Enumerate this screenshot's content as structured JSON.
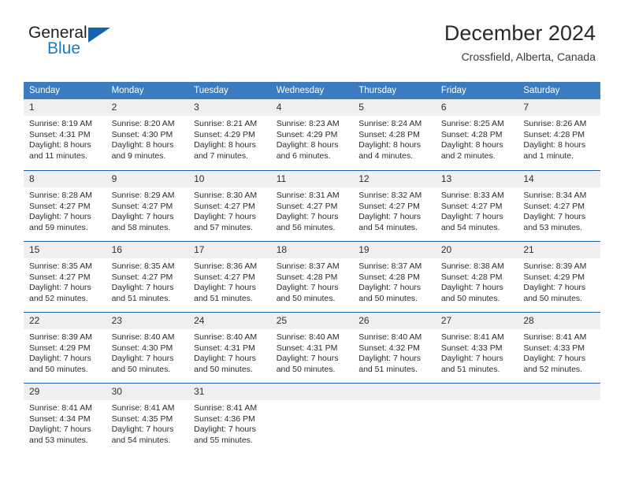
{
  "brand": {
    "name_primary": "General",
    "name_secondary": "Blue",
    "triangle_color": "#1665ab"
  },
  "header": {
    "title": "December 2024",
    "location": "Crossfield, Alberta, Canada"
  },
  "calendar": {
    "weekday_headers": [
      "Sunday",
      "Monday",
      "Tuesday",
      "Wednesday",
      "Thursday",
      "Friday",
      "Saturday"
    ],
    "header_bg": "#3b7cc0",
    "row_divider_color": "#1f61a8",
    "daynum_bg": "#efefef",
    "weeks": [
      [
        {
          "day": "1",
          "sunrise": "Sunrise: 8:19 AM",
          "sunset": "Sunset: 4:31 PM",
          "daylight_1": "Daylight: 8 hours",
          "daylight_2": "and 11 minutes."
        },
        {
          "day": "2",
          "sunrise": "Sunrise: 8:20 AM",
          "sunset": "Sunset: 4:30 PM",
          "daylight_1": "Daylight: 8 hours",
          "daylight_2": "and 9 minutes."
        },
        {
          "day": "3",
          "sunrise": "Sunrise: 8:21 AM",
          "sunset": "Sunset: 4:29 PM",
          "daylight_1": "Daylight: 8 hours",
          "daylight_2": "and 7 minutes."
        },
        {
          "day": "4",
          "sunrise": "Sunrise: 8:23 AM",
          "sunset": "Sunset: 4:29 PM",
          "daylight_1": "Daylight: 8 hours",
          "daylight_2": "and 6 minutes."
        },
        {
          "day": "5",
          "sunrise": "Sunrise: 8:24 AM",
          "sunset": "Sunset: 4:28 PM",
          "daylight_1": "Daylight: 8 hours",
          "daylight_2": "and 4 minutes."
        },
        {
          "day": "6",
          "sunrise": "Sunrise: 8:25 AM",
          "sunset": "Sunset: 4:28 PM",
          "daylight_1": "Daylight: 8 hours",
          "daylight_2": "and 2 minutes."
        },
        {
          "day": "7",
          "sunrise": "Sunrise: 8:26 AM",
          "sunset": "Sunset: 4:28 PM",
          "daylight_1": "Daylight: 8 hours",
          "daylight_2": "and 1 minute."
        }
      ],
      [
        {
          "day": "8",
          "sunrise": "Sunrise: 8:28 AM",
          "sunset": "Sunset: 4:27 PM",
          "daylight_1": "Daylight: 7 hours",
          "daylight_2": "and 59 minutes."
        },
        {
          "day": "9",
          "sunrise": "Sunrise: 8:29 AM",
          "sunset": "Sunset: 4:27 PM",
          "daylight_1": "Daylight: 7 hours",
          "daylight_2": "and 58 minutes."
        },
        {
          "day": "10",
          "sunrise": "Sunrise: 8:30 AM",
          "sunset": "Sunset: 4:27 PM",
          "daylight_1": "Daylight: 7 hours",
          "daylight_2": "and 57 minutes."
        },
        {
          "day": "11",
          "sunrise": "Sunrise: 8:31 AM",
          "sunset": "Sunset: 4:27 PM",
          "daylight_1": "Daylight: 7 hours",
          "daylight_2": "and 56 minutes."
        },
        {
          "day": "12",
          "sunrise": "Sunrise: 8:32 AM",
          "sunset": "Sunset: 4:27 PM",
          "daylight_1": "Daylight: 7 hours",
          "daylight_2": "and 54 minutes."
        },
        {
          "day": "13",
          "sunrise": "Sunrise: 8:33 AM",
          "sunset": "Sunset: 4:27 PM",
          "daylight_1": "Daylight: 7 hours",
          "daylight_2": "and 54 minutes."
        },
        {
          "day": "14",
          "sunrise": "Sunrise: 8:34 AM",
          "sunset": "Sunset: 4:27 PM",
          "daylight_1": "Daylight: 7 hours",
          "daylight_2": "and 53 minutes."
        }
      ],
      [
        {
          "day": "15",
          "sunrise": "Sunrise: 8:35 AM",
          "sunset": "Sunset: 4:27 PM",
          "daylight_1": "Daylight: 7 hours",
          "daylight_2": "and 52 minutes."
        },
        {
          "day": "16",
          "sunrise": "Sunrise: 8:35 AM",
          "sunset": "Sunset: 4:27 PM",
          "daylight_1": "Daylight: 7 hours",
          "daylight_2": "and 51 minutes."
        },
        {
          "day": "17",
          "sunrise": "Sunrise: 8:36 AM",
          "sunset": "Sunset: 4:27 PM",
          "daylight_1": "Daylight: 7 hours",
          "daylight_2": "and 51 minutes."
        },
        {
          "day": "18",
          "sunrise": "Sunrise: 8:37 AM",
          "sunset": "Sunset: 4:28 PM",
          "daylight_1": "Daylight: 7 hours",
          "daylight_2": "and 50 minutes."
        },
        {
          "day": "19",
          "sunrise": "Sunrise: 8:37 AM",
          "sunset": "Sunset: 4:28 PM",
          "daylight_1": "Daylight: 7 hours",
          "daylight_2": "and 50 minutes."
        },
        {
          "day": "20",
          "sunrise": "Sunrise: 8:38 AM",
          "sunset": "Sunset: 4:28 PM",
          "daylight_1": "Daylight: 7 hours",
          "daylight_2": "and 50 minutes."
        },
        {
          "day": "21",
          "sunrise": "Sunrise: 8:39 AM",
          "sunset": "Sunset: 4:29 PM",
          "daylight_1": "Daylight: 7 hours",
          "daylight_2": "and 50 minutes."
        }
      ],
      [
        {
          "day": "22",
          "sunrise": "Sunrise: 8:39 AM",
          "sunset": "Sunset: 4:29 PM",
          "daylight_1": "Daylight: 7 hours",
          "daylight_2": "and 50 minutes."
        },
        {
          "day": "23",
          "sunrise": "Sunrise: 8:40 AM",
          "sunset": "Sunset: 4:30 PM",
          "daylight_1": "Daylight: 7 hours",
          "daylight_2": "and 50 minutes."
        },
        {
          "day": "24",
          "sunrise": "Sunrise: 8:40 AM",
          "sunset": "Sunset: 4:31 PM",
          "daylight_1": "Daylight: 7 hours",
          "daylight_2": "and 50 minutes."
        },
        {
          "day": "25",
          "sunrise": "Sunrise: 8:40 AM",
          "sunset": "Sunset: 4:31 PM",
          "daylight_1": "Daylight: 7 hours",
          "daylight_2": "and 50 minutes."
        },
        {
          "day": "26",
          "sunrise": "Sunrise: 8:40 AM",
          "sunset": "Sunset: 4:32 PM",
          "daylight_1": "Daylight: 7 hours",
          "daylight_2": "and 51 minutes."
        },
        {
          "day": "27",
          "sunrise": "Sunrise: 8:41 AM",
          "sunset": "Sunset: 4:33 PM",
          "daylight_1": "Daylight: 7 hours",
          "daylight_2": "and 51 minutes."
        },
        {
          "day": "28",
          "sunrise": "Sunrise: 8:41 AM",
          "sunset": "Sunset: 4:33 PM",
          "daylight_1": "Daylight: 7 hours",
          "daylight_2": "and 52 minutes."
        }
      ],
      [
        {
          "day": "29",
          "sunrise": "Sunrise: 8:41 AM",
          "sunset": "Sunset: 4:34 PM",
          "daylight_1": "Daylight: 7 hours",
          "daylight_2": "and 53 minutes."
        },
        {
          "day": "30",
          "sunrise": "Sunrise: 8:41 AM",
          "sunset": "Sunset: 4:35 PM",
          "daylight_1": "Daylight: 7 hours",
          "daylight_2": "and 54 minutes."
        },
        {
          "day": "31",
          "sunrise": "Sunrise: 8:41 AM",
          "sunset": "Sunset: 4:36 PM",
          "daylight_1": "Daylight: 7 hours",
          "daylight_2": "and 55 minutes."
        },
        {
          "day": "",
          "sunrise": "",
          "sunset": "",
          "daylight_1": "",
          "daylight_2": ""
        },
        {
          "day": "",
          "sunrise": "",
          "sunset": "",
          "daylight_1": "",
          "daylight_2": ""
        },
        {
          "day": "",
          "sunrise": "",
          "sunset": "",
          "daylight_1": "",
          "daylight_2": ""
        },
        {
          "day": "",
          "sunrise": "",
          "sunset": "",
          "daylight_1": "",
          "daylight_2": ""
        }
      ]
    ]
  }
}
